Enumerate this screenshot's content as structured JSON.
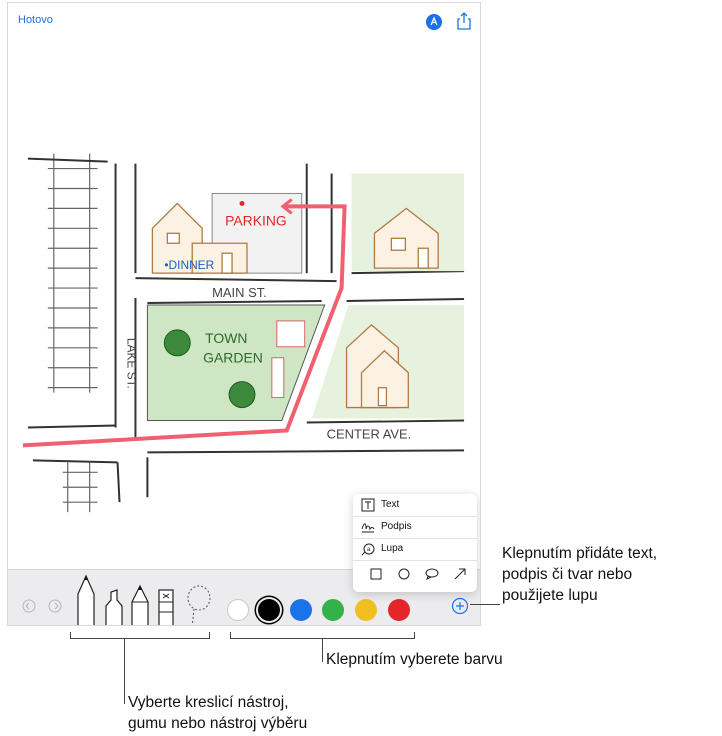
{
  "top_bar": {
    "done_label": "Hotovo"
  },
  "map": {
    "labels": {
      "parking": "PARKING",
      "dinner": "•DINNER",
      "main_st": "MAIN ST.",
      "lake_st": "LAKE ST.",
      "town": "TOWN",
      "garden": "GARDEN",
      "center_ave": "CENTER AVE."
    }
  },
  "add_menu": {
    "items": [
      {
        "label": "Text",
        "icon": "text-box-icon"
      },
      {
        "label": "Podpis",
        "icon": "signature-icon"
      },
      {
        "label": "Lupa",
        "icon": "magnifier-icon"
      }
    ],
    "shapes": [
      "square-icon",
      "circle-icon",
      "speech-bubble-icon",
      "arrow-icon"
    ]
  },
  "toolbar": {
    "tools": [
      "pen-tool",
      "marker-tool",
      "pencil-tool",
      "eraser-tool",
      "lasso-tool"
    ],
    "colors": [
      "#ffffff",
      "#000000",
      "#1a73e8",
      "#34b24a",
      "#f0c020",
      "#e5252a"
    ],
    "selected_color": "#000000"
  },
  "callouts": {
    "add": [
      "Klepnutím přidáte text,",
      "podpis či tvar nebo",
      "použijete lupu"
    ],
    "color": "Klepnutím vyberete barvu",
    "tools": [
      "Vyberte kreslicí nástroj,",
      "gumu nebo nástroj výběru"
    ]
  }
}
